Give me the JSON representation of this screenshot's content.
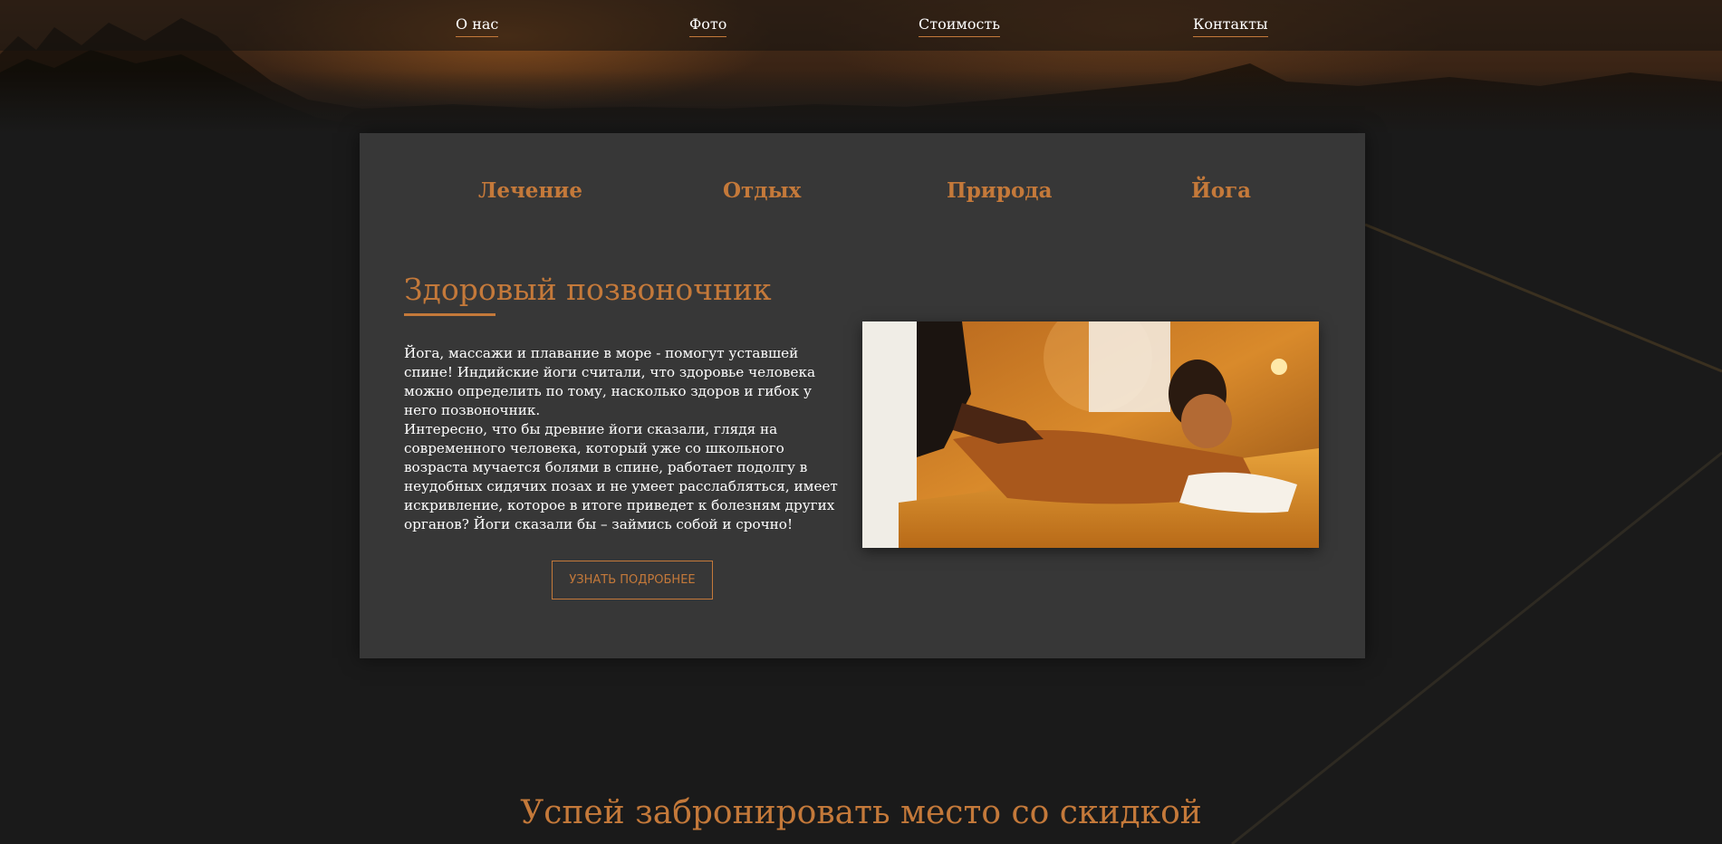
{
  "nav": {
    "items": [
      {
        "label": "О нас"
      },
      {
        "label": "Фото"
      },
      {
        "label": "Стоимость"
      },
      {
        "label": "Контакты"
      }
    ]
  },
  "card": {
    "tabs": [
      {
        "label": "Лечение"
      },
      {
        "label": "Отдых"
      },
      {
        "label": "Природа"
      },
      {
        "label": "Йога"
      }
    ],
    "title": "Здоровый позвоночник",
    "paragraph1": "Йога, массажи и плавание в море - помогут уставшей спине! Индийские йоги считали, что здоровье человека можно определить по тому, насколько здоров и гибок у него позвоночник.",
    "paragraph2": "Интересно, что бы древние йоги сказали, глядя на современного человека, который уже со школьного возраста мучается болями в спине, работает подолгу в неудобных сидячих позах и не умеет расслабляться, имеет искривление, которое в итоге приведет к болезням других органов? Йоги сказали бы – займись собой и срочно!",
    "button_label": "УЗНАТЬ ПОДРОБНЕЕ",
    "image_icon": "massage-photo"
  },
  "promo": {
    "heading": "Успей забронировать место со скидкой"
  },
  "colors": {
    "accent": "#c4793a",
    "card_bg": "#373737",
    "page_bg": "#1a1a1a"
  }
}
